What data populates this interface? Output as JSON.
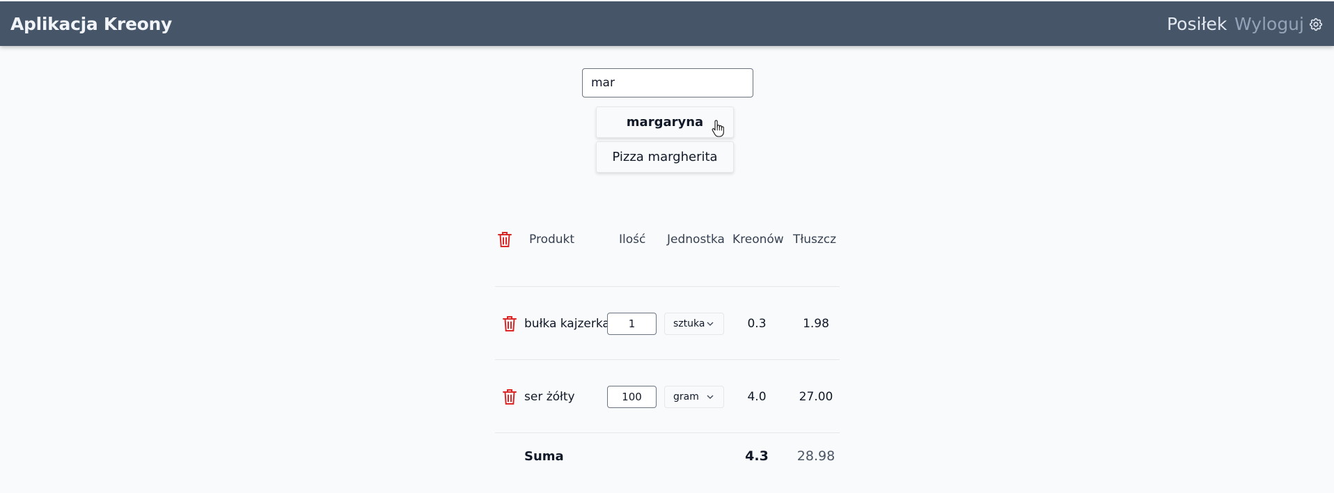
{
  "header": {
    "app_title": "Aplikacja Kreony",
    "nav_meal": "Posiłek",
    "nav_logout": "Wyloguj",
    "settings_icon": "gear-icon",
    "bg_color": "#475569"
  },
  "search": {
    "value": "mar",
    "suggestions": [
      "margaryna",
      "Pizza margherita"
    ]
  },
  "table": {
    "headers": {
      "product": "Produkt",
      "quantity": "Ilość",
      "unit": "Jednostka",
      "kreons": "Kreonów",
      "fat": "Tłuszcz"
    },
    "rows": [
      {
        "product": "bułka kajzerka",
        "quantity": "1",
        "unit": "sztuka",
        "kreons": "0.3",
        "fat": "1.98"
      },
      {
        "product": "ser żółty",
        "quantity": "100",
        "unit": "gram",
        "kreons": "4.0",
        "fat": "27.00"
      }
    ],
    "sum": {
      "label": "Suma",
      "kreons": "4.3",
      "fat": "28.98"
    },
    "delete_icon": "trash-icon",
    "delete_color": "#dc2626"
  }
}
